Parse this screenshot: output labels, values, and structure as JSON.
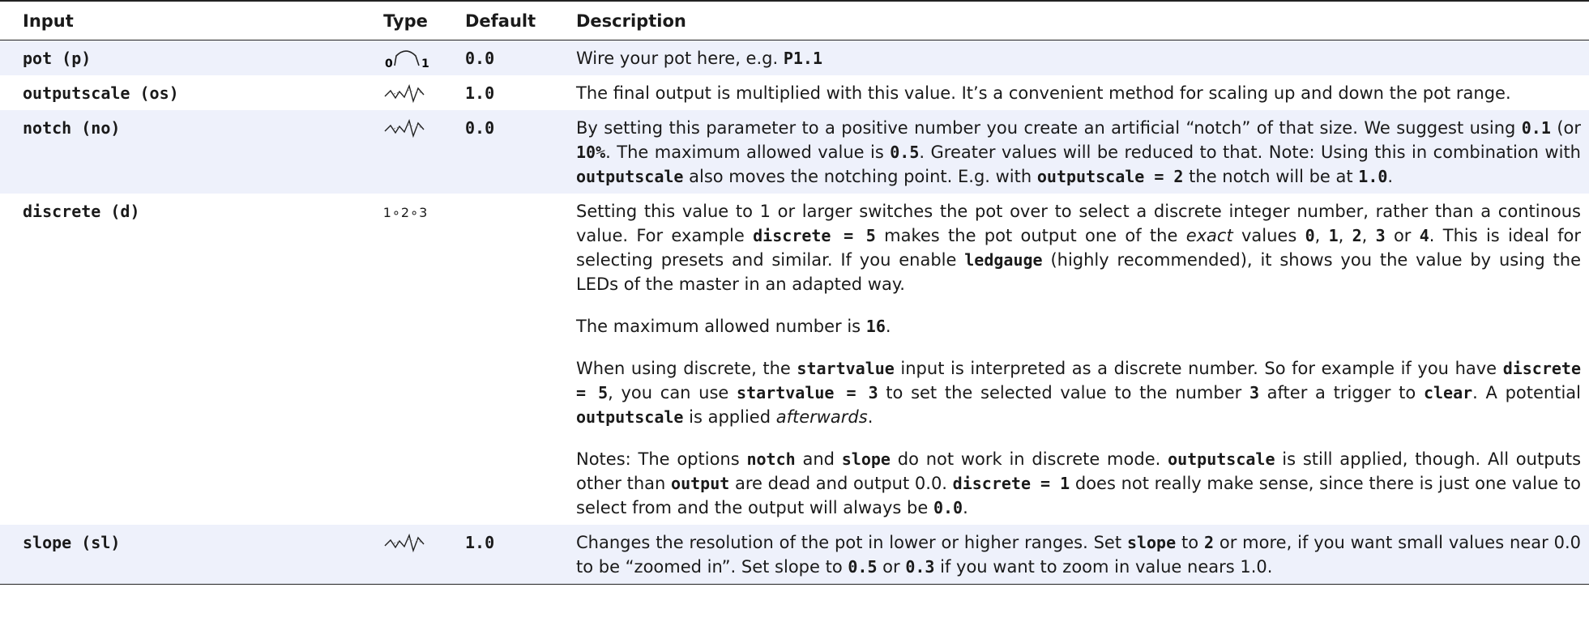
{
  "headers": {
    "input": "Input",
    "type": "Type",
    "default": "Default",
    "description": "Description"
  },
  "rows": [
    {
      "name": "pot (p)",
      "type_icon": "pot-range-icon",
      "type_label_low": "0",
      "type_label_high": "1",
      "default": "0.0",
      "desc": {
        "p1_t1": "Wire your pot here, e.g. ",
        "p1_c1": "P1.1"
      }
    },
    {
      "name": "outputscale (os)",
      "type_icon": "cv-wave-icon",
      "default": "1.0",
      "desc": {
        "p1_t1": "The final output is multiplied with this value. It’s a convenient method for scaling up and down the pot range."
      }
    },
    {
      "name": "notch (no)",
      "type_icon": "cv-wave-icon",
      "default": "0.0",
      "desc": {
        "p1_t1": "By setting this parameter to a positive number you create an artificial “notch” of that size. We suggest using ",
        "p1_c1": "0.1",
        "p1_t2": " (or ",
        "p1_c2": "10%",
        "p1_t3": ". The maximum allowed value is ",
        "p1_c3": "0.5",
        "p1_t4": ". Greater values will be reduced to that. Note: Using this in combination with ",
        "p1_c4": "outputscale",
        "p1_t5": " also moves the notching point. E.g. with ",
        "p1_c5": "outputscale = 2",
        "p1_t6": " the notch will be at ",
        "p1_c6": "1.0",
        "p1_t7": "."
      }
    },
    {
      "name": "discrete (d)",
      "type_icon": "discrete-steps-icon",
      "type_text": "1∘2∘3",
      "default": "",
      "desc": {
        "p1_t1": "Setting this value to 1 or larger switches the pot over to select a discrete integer number, rather than a continous value. For example ",
        "p1_c1": "discrete = 5",
        "p1_t2": " makes the pot output one of the ",
        "p1_e1": "exact",
        "p1_t3": " values ",
        "p1_c2": "0",
        "p1_t4": ", ",
        "p1_c3": "1",
        "p1_t5": ", ",
        "p1_c4": "2",
        "p1_t6": ", ",
        "p1_c5": "3",
        "p1_t7": " or ",
        "p1_c6": "4",
        "p1_t8": ". This is ideal for selecting presets and similar. If you enable ",
        "p1_c7": "ledgauge",
        "p1_t9": " (highly recommended), it shows you the value by using the LEDs of the master in an adapted way.",
        "p2_t1": "The maximum allowed number is ",
        "p2_c1": "16",
        "p2_t2": ".",
        "p3_t1": "When using discrete, the ",
        "p3_c1": "startvalue",
        "p3_t2": " input is interpreted as a discrete number. So for example if you have ",
        "p3_c2": "discrete = 5",
        "p3_t3": ", you can use ",
        "p3_c3": "startvalue = 3",
        "p3_t4": " to set the selected value to the number ",
        "p3_c4": "3",
        "p3_t5": " after a trigger to ",
        "p3_c5": "clear",
        "p3_t6": ". A potential ",
        "p3_c6": "outputscale",
        "p3_t7": " is applied ",
        "p3_e1": "afterwards",
        "p3_t8": ".",
        "p4_t1": "Notes: The options ",
        "p4_c1": "notch",
        "p4_t2": " and ",
        "p4_c2": "slope",
        "p4_t3": " do not work in discrete mode. ",
        "p4_c3": "outputscale",
        "p4_t4": " is still applied, though. All outputs other than ",
        "p4_c4": "output",
        "p4_t5": " are dead and output 0.0. ",
        "p4_c5": "discrete = 1",
        "p4_t6": " does not really make sense, since there is just one value to select from and the output will always be ",
        "p4_c6": "0.0",
        "p4_t7": "."
      }
    },
    {
      "name": "slope (sl)",
      "type_icon": "cv-wave-icon",
      "default": "1.0",
      "desc": {
        "p1_t1": "Changes the resolution of the pot in lower or higher ranges. Set ",
        "p1_c1": "slope",
        "p1_t2": " to ",
        "p1_c2": "2",
        "p1_t3": " or more, if you want small values near 0.0 to be “zoomed in”. Set slope to ",
        "p1_c3": "0.5",
        "p1_t4": " or ",
        "p1_c4": "0.3",
        "p1_t5": " if you want to zoom in value nears 1.0."
      }
    }
  ]
}
